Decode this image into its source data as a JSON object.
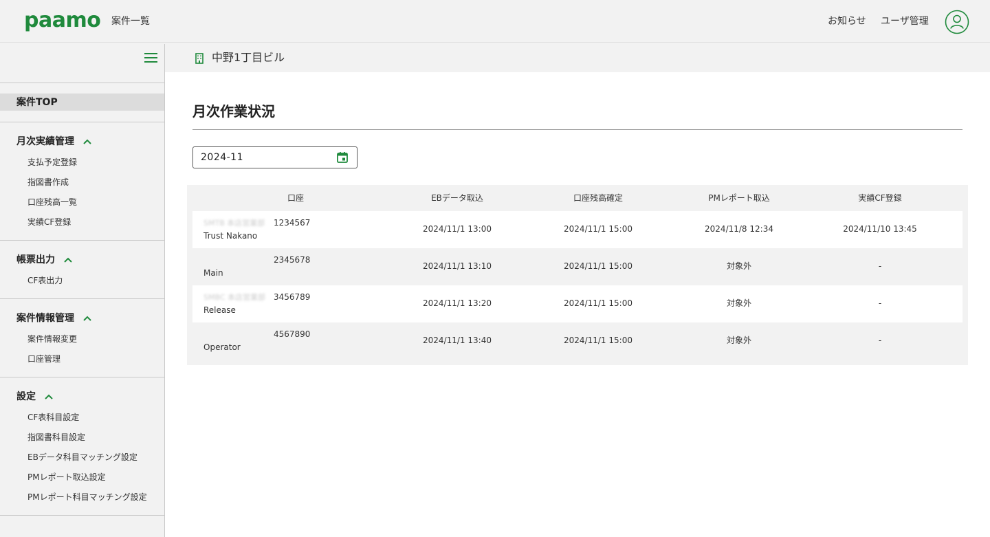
{
  "header": {
    "logo": "paamo",
    "nav_cases": "案件一覧",
    "nav_news": "お知らせ",
    "nav_users": "ユーザ管理",
    "avatar_icon": "user-circle-icon",
    "brand_color": "#1f8a3c"
  },
  "sidebar": {
    "menu_icon": "hamburger-icon",
    "top_label": "案件TOP",
    "sections": [
      {
        "title": "月次実績管理",
        "items": [
          "支払予定登録",
          "指図書作成",
          "口座残高一覧",
          "実績CF登録"
        ]
      },
      {
        "title": "帳票出力",
        "items": [
          "CF表出力"
        ]
      },
      {
        "title": "案件情報管理",
        "items": [
          "案件情報変更",
          "口座管理"
        ]
      },
      {
        "title": "設定",
        "items": [
          "CF表科目設定",
          "指図書科目設定",
          "EBデータ科目マッチング設定",
          "PMレポート取込設定",
          "PMレポート科目マッチング設定"
        ]
      }
    ]
  },
  "subheader": {
    "building_icon": "building-icon",
    "building_name": "中野1丁目ビル"
  },
  "main": {
    "title": "月次作業状況",
    "month_value": "2024-11",
    "calendar_icon": "calendar-icon"
  },
  "table": {
    "headers": [
      "口座",
      "EBデータ取込",
      "口座残高確定",
      "PMレポート取込",
      "実績CF登録"
    ],
    "rows": [
      {
        "bank": "SMTB 本店営業部",
        "account_no": "1234567",
        "account_name": "Trust Nakano",
        "eb_import": "2024/11/1 13:00",
        "balance_confirm": "2024/11/1 15:00",
        "pm_import": "2024/11/8 12:34",
        "cf_register": "2024/11/10 13:45"
      },
      {
        "bank": "",
        "account_no": "2345678",
        "account_name": "Main",
        "eb_import": "2024/11/1 13:10",
        "balance_confirm": "2024/11/1 15:00",
        "pm_import": "対象外",
        "cf_register": "-"
      },
      {
        "bank": "SMBC 本店営業部",
        "account_no": "3456789",
        "account_name": "Release",
        "eb_import": "2024/11/1 13:20",
        "balance_confirm": "2024/11/1 15:00",
        "pm_import": "対象外",
        "cf_register": "-"
      },
      {
        "bank": "",
        "account_no": "4567890",
        "account_name": "Operator",
        "eb_import": "2024/11/1 13:40",
        "balance_confirm": "2024/11/1 15:00",
        "pm_import": "対象外",
        "cf_register": "-"
      }
    ]
  }
}
